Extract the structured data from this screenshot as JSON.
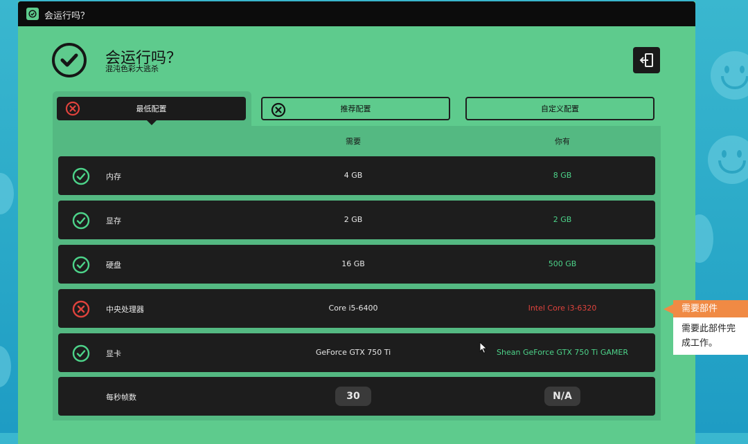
{
  "window": {
    "title": "会运行吗？"
  },
  "header": {
    "title": "会运行吗？",
    "subtitle": "混沌色彩大逃杀",
    "exit_icon": "exit-icon"
  },
  "tabs": [
    {
      "label": "最低配置",
      "active": true
    },
    {
      "label": "推荐配置",
      "active": false
    },
    {
      "label": "自定义配置",
      "active": false
    }
  ],
  "columns": {
    "need": "需要",
    "have": "你有"
  },
  "rows": [
    {
      "label": "内存",
      "required": "4 GB",
      "have": "8 GB",
      "status": "pass"
    },
    {
      "label": "显存",
      "required": "2 GB",
      "have": "2 GB",
      "status": "pass"
    },
    {
      "label": "硬盘",
      "required": "16 GB",
      "have": "500 GB",
      "status": "pass"
    },
    {
      "label": "中央处理器",
      "required": "Core i5-6400",
      "have": "Intel Core i3-6320",
      "status": "fail"
    },
    {
      "label": "显卡",
      "required": "GeForce GTX 750 Ti",
      "have": "Shean GeForce GTX 750 Ti GAMER",
      "status": "pass"
    },
    {
      "label": "每秒帧数",
      "required": "30",
      "have": "N/A",
      "status": "none"
    }
  ],
  "tooltip": {
    "title": "需要部件",
    "body": "需要此部件完成工作。"
  },
  "colors": {
    "pass": "#4dd48a",
    "fail": "#e0433d",
    "accent": "#5ecb8d",
    "tooltip": "#f08a44"
  }
}
